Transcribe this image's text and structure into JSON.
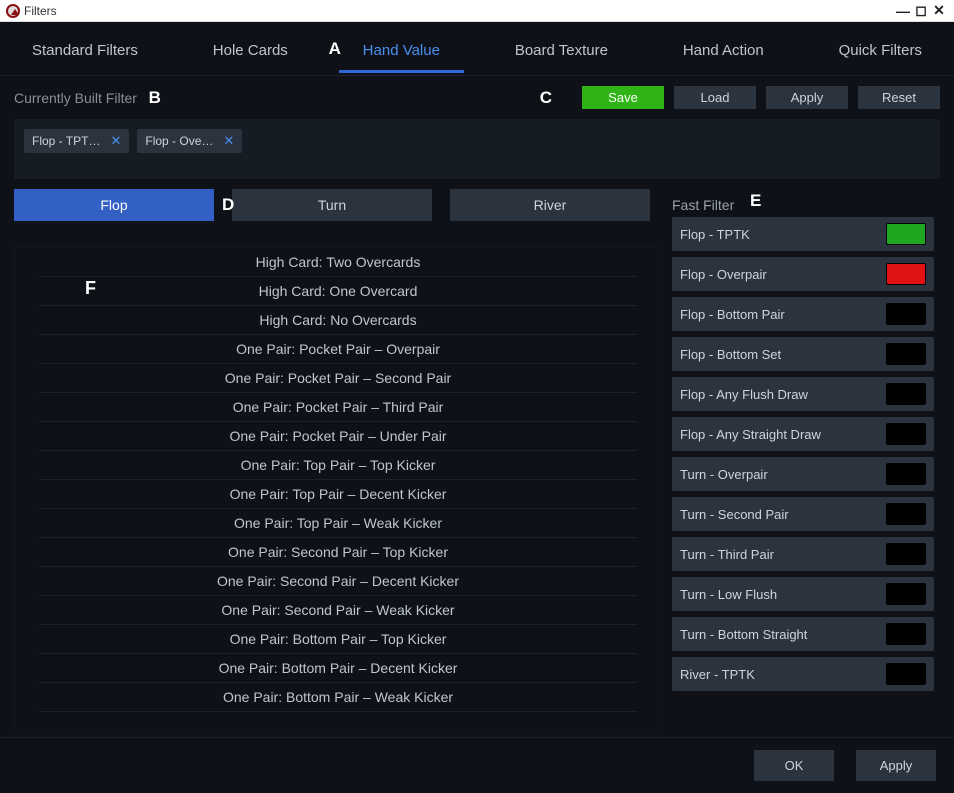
{
  "window": {
    "title": "Filters"
  },
  "tabs": {
    "items": [
      "Standard Filters",
      "Hole Cards",
      "Hand Value",
      "Board Texture",
      "Hand Action",
      "Quick Filters"
    ],
    "active": 2
  },
  "markers": {
    "a": "A",
    "b": "B",
    "c": "C",
    "d": "D",
    "e": "E",
    "f": "F"
  },
  "built": {
    "label": "Currently Built Filter",
    "chips": [
      "Flop - TPT…",
      "Flop - Ove…"
    ]
  },
  "buttons": {
    "save": "Save",
    "load": "Load",
    "apply": "Apply",
    "reset": "Reset",
    "ok": "OK"
  },
  "streets": {
    "items": [
      "Flop",
      "Turn",
      "River"
    ],
    "active": 0
  },
  "categories": [
    "High Card: Two Overcards",
    "High Card: One Overcard",
    "High Card: No Overcards",
    "One Pair: Pocket Pair – Overpair",
    "One Pair: Pocket Pair – Second Pair",
    "One Pair: Pocket Pair – Third Pair",
    "One Pair: Pocket Pair – Under Pair",
    "One Pair: Top Pair – Top Kicker",
    "One Pair: Top Pair – Decent Kicker",
    "One Pair: Top Pair – Weak Kicker",
    "One Pair: Second Pair – Top Kicker",
    "One Pair: Second Pair – Decent Kicker",
    "One Pair: Second Pair – Weak Kicker",
    "One Pair: Bottom Pair – Top Kicker",
    "One Pair: Bottom Pair – Decent Kicker",
    "One Pair: Bottom Pair – Weak Kicker"
  ],
  "fast": {
    "label": "Fast Filter",
    "items": [
      {
        "label": "Flop - TPTK",
        "color": "#1fa81f"
      },
      {
        "label": "Flop - Overpair",
        "color": "#e01212"
      },
      {
        "label": "Flop - Bottom Pair",
        "color": "#000000"
      },
      {
        "label": "Flop - Bottom Set",
        "color": "#000000"
      },
      {
        "label": "Flop - Any Flush Draw",
        "color": "#000000"
      },
      {
        "label": "Flop - Any Straight Draw",
        "color": "#000000"
      },
      {
        "label": "Turn - Overpair",
        "color": "#000000"
      },
      {
        "label": "Turn - Second Pair",
        "color": "#000000"
      },
      {
        "label": "Turn - Third Pair",
        "color": "#000000"
      },
      {
        "label": "Turn - Low Flush",
        "color": "#000000"
      },
      {
        "label": "Turn - Bottom Straight",
        "color": "#000000"
      },
      {
        "label": "River - TPTK",
        "color": "#000000"
      }
    ]
  }
}
